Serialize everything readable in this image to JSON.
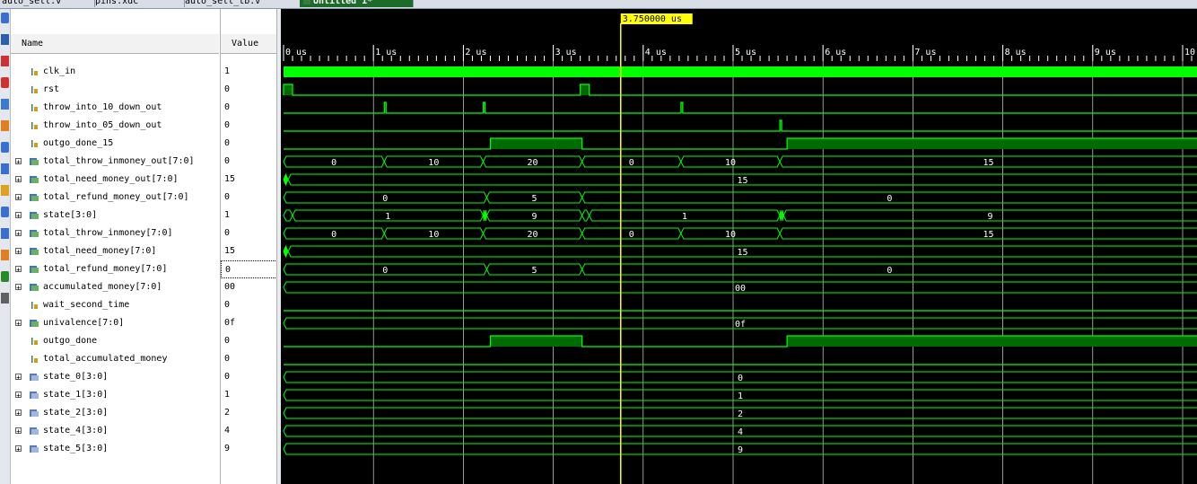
{
  "tabs": [
    {
      "label": "auto_sell.v",
      "active": false
    },
    {
      "label": "pins.xdc",
      "active": false
    },
    {
      "label": "auto_sell_tb.v",
      "active": false
    },
    {
      "label": "Untitled 1*",
      "active": true
    }
  ],
  "columns": {
    "name": "Name",
    "value": "Value"
  },
  "cursor": {
    "label": "3.750000 us",
    "time": 3.75
  },
  "time_axis": {
    "unit": "us",
    "start": 0,
    "end": 10,
    "labels": [
      "0 us",
      "1 us",
      "2 us",
      "3 us",
      "4 us",
      "5 us",
      "6 us",
      "7 us",
      "8 us",
      "9 us",
      "10"
    ]
  },
  "colors": {
    "wave": "#00ff00",
    "wave_high_fill": "#006b00",
    "background": "#000000",
    "cursor": "#ffff00",
    "grid": "#ffffff"
  },
  "toolbar_icons": [
    "zoom-fit-icon",
    "save-icon",
    "zoom-in-icon",
    "zoom-out-icon",
    "go-to-cursor-icon",
    "previous-transition-icon",
    "next-transition-icon",
    "add-marker-icon",
    "previous-marker-icon",
    "next-marker-icon",
    "swap-cursors-icon",
    "cut-icon",
    "snap-icon",
    "settings-icon"
  ],
  "signals": [
    {
      "name": "clk_in",
      "value": "1",
      "type": "bit",
      "expandable": false,
      "wave": {
        "kind": "clock"
      }
    },
    {
      "name": "rst",
      "value": "0",
      "type": "bit",
      "expandable": false,
      "wave": {
        "kind": "bit",
        "init": 0,
        "edges": [
          0.0,
          0.1,
          3.3,
          3.4
        ]
      }
    },
    {
      "name": "throw_into_10_down_out",
      "value": "0",
      "type": "bit",
      "expandable": false,
      "wave": {
        "kind": "bit",
        "init": 0,
        "edges": [
          1.12,
          1.14,
          2.22,
          2.24,
          4.42,
          4.44
        ]
      }
    },
    {
      "name": "throw_into_05_down_out",
      "value": "0",
      "type": "bit",
      "expandable": false,
      "wave": {
        "kind": "bit",
        "init": 0,
        "edges": [
          5.52,
          5.54
        ]
      }
    },
    {
      "name": "outgo_done_15",
      "value": "0",
      "type": "bit",
      "expandable": false,
      "wave": {
        "kind": "bit",
        "init": 0,
        "edges": [
          2.3,
          3.32,
          5.6
        ]
      }
    },
    {
      "name": "total_throw_inmoney_out[7:0]",
      "value": "0",
      "type": "bus",
      "expandable": true,
      "wave": {
        "kind": "bus",
        "segments": [
          {
            "from": 0.0,
            "to": 1.12,
            "label": "0"
          },
          {
            "from": 1.12,
            "to": 2.22,
            "label": "10"
          },
          {
            "from": 2.22,
            "to": 3.32,
            "label": "20"
          },
          {
            "from": 3.32,
            "to": 4.42,
            "label": "0"
          },
          {
            "from": 4.42,
            "to": 5.52,
            "label": "10"
          },
          {
            "from": 5.52,
            "to": 10.3,
            "label": "15"
          }
        ]
      }
    },
    {
      "name": "total_need_money_out[7:0]",
      "value": "15",
      "type": "bus",
      "expandable": true,
      "wave": {
        "kind": "bus",
        "segments": [
          {
            "from": 0.0,
            "to": 0.05,
            "label": ""
          },
          {
            "from": 0.05,
            "to": 10.3,
            "label": "15"
          }
        ]
      }
    },
    {
      "name": "total_refund_money_out[7:0]",
      "value": "0",
      "type": "bus",
      "expandable": true,
      "wave": {
        "kind": "bus",
        "segments": [
          {
            "from": 0.0,
            "to": 2.26,
            "label": "0"
          },
          {
            "from": 2.26,
            "to": 3.32,
            "label": "5"
          },
          {
            "from": 3.32,
            "to": 10.3,
            "label": "0"
          }
        ]
      }
    },
    {
      "name": "state[3:0]",
      "value": "1",
      "type": "bus",
      "expandable": true,
      "wave": {
        "kind": "bus",
        "segments": [
          {
            "from": 0.0,
            "to": 0.1,
            "label": ""
          },
          {
            "from": 0.1,
            "to": 2.22,
            "label": "1"
          },
          {
            "from": 2.22,
            "to": 2.24,
            "label": ""
          },
          {
            "from": 2.24,
            "to": 2.26,
            "label": ""
          },
          {
            "from": 2.26,
            "to": 3.32,
            "label": "9"
          },
          {
            "from": 3.32,
            "to": 3.4,
            "label": ""
          },
          {
            "from": 3.4,
            "to": 5.52,
            "label": "1"
          },
          {
            "from": 5.52,
            "to": 5.54,
            "label": ""
          },
          {
            "from": 5.54,
            "to": 5.56,
            "label": ""
          },
          {
            "from": 5.56,
            "to": 10.3,
            "label": "9"
          }
        ]
      }
    },
    {
      "name": "total_throw_inmoney[7:0]",
      "value": "0",
      "type": "bus",
      "expandable": true,
      "wave": {
        "kind": "bus",
        "segments": [
          {
            "from": 0.0,
            "to": 1.12,
            "label": "0"
          },
          {
            "from": 1.12,
            "to": 2.22,
            "label": "10"
          },
          {
            "from": 2.22,
            "to": 3.32,
            "label": "20"
          },
          {
            "from": 3.32,
            "to": 4.42,
            "label": "0"
          },
          {
            "from": 4.42,
            "to": 5.52,
            "label": "10"
          },
          {
            "from": 5.52,
            "to": 10.3,
            "label": "15"
          }
        ]
      }
    },
    {
      "name": "total_need_money[7:0]",
      "value": "15",
      "type": "bus",
      "expandable": true,
      "wave": {
        "kind": "bus",
        "segments": [
          {
            "from": 0.0,
            "to": 0.05,
            "label": ""
          },
          {
            "from": 0.05,
            "to": 10.3,
            "label": "15"
          }
        ]
      }
    },
    {
      "name": "total_refund_money[7:0]",
      "value": "0",
      "type": "bus",
      "expandable": true,
      "selected": true,
      "wave": {
        "kind": "bus",
        "segments": [
          {
            "from": 0.0,
            "to": 2.26,
            "label": "0"
          },
          {
            "from": 2.26,
            "to": 3.32,
            "label": "5"
          },
          {
            "from": 3.32,
            "to": 10.3,
            "label": "0"
          }
        ]
      }
    },
    {
      "name": "accumulated_money[7:0]",
      "value": "00",
      "type": "bus",
      "expandable": true,
      "wave": {
        "kind": "bus",
        "segments": [
          {
            "from": 0.0,
            "to": 10.3,
            "label": "00"
          }
        ]
      }
    },
    {
      "name": "wait_second_time",
      "value": "0",
      "type": "bit",
      "expandable": false,
      "wave": {
        "kind": "bit",
        "init": 0,
        "edges": []
      }
    },
    {
      "name": "univalence[7:0]",
      "value": "0f",
      "type": "bus",
      "expandable": true,
      "wave": {
        "kind": "bus",
        "segments": [
          {
            "from": 0.0,
            "to": 10.3,
            "label": "0f"
          }
        ]
      }
    },
    {
      "name": "outgo_done",
      "value": "0",
      "type": "bit",
      "expandable": false,
      "wave": {
        "kind": "bit",
        "init": 0,
        "edges": [
          2.3,
          3.32,
          5.6
        ]
      }
    },
    {
      "name": "total_accumulated_money",
      "value": "0",
      "type": "bit",
      "expandable": false,
      "wave": {
        "kind": "bit",
        "init": 0,
        "edges": []
      }
    },
    {
      "name": "state_0[3:0]",
      "value": "0",
      "type": "param",
      "expandable": true,
      "wave": {
        "kind": "bus",
        "segments": [
          {
            "from": 0.0,
            "to": 10.3,
            "label": "0"
          }
        ]
      }
    },
    {
      "name": "state_1[3:0]",
      "value": "1",
      "type": "param",
      "expandable": true,
      "wave": {
        "kind": "bus",
        "segments": [
          {
            "from": 0.0,
            "to": 10.3,
            "label": "1"
          }
        ]
      }
    },
    {
      "name": "state_2[3:0]",
      "value": "2",
      "type": "param",
      "expandable": true,
      "wave": {
        "kind": "bus",
        "segments": [
          {
            "from": 0.0,
            "to": 10.3,
            "label": "2"
          }
        ]
      }
    },
    {
      "name": "state_4[3:0]",
      "value": "4",
      "type": "param",
      "expandable": true,
      "wave": {
        "kind": "bus",
        "segments": [
          {
            "from": 0.0,
            "to": 10.3,
            "label": "4"
          }
        ]
      }
    },
    {
      "name": "state_5[3:0]",
      "value": "9",
      "type": "param",
      "expandable": true,
      "wave": {
        "kind": "bus",
        "segments": [
          {
            "from": 0.0,
            "to": 10.3,
            "label": "9"
          }
        ]
      }
    }
  ]
}
